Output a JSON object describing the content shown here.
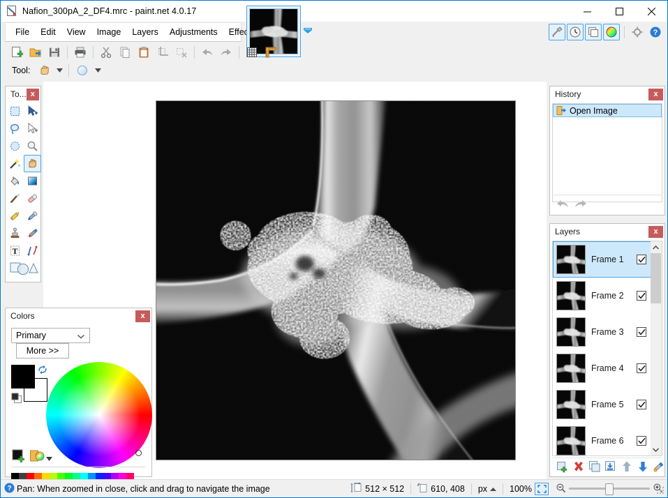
{
  "window": {
    "title": "Nafion_300pA_2_DF4.mrc - paint.net 4.0.17",
    "icon": "paintnet-document-icon",
    "controls": {
      "minimize": "—",
      "maximize": "□",
      "close": "✕"
    }
  },
  "menu": {
    "items": [
      {
        "label": "File"
      },
      {
        "label": "Edit"
      },
      {
        "label": "View"
      },
      {
        "label": "Image"
      },
      {
        "label": "Layers"
      },
      {
        "label": "Adjustments"
      },
      {
        "label": "Effects"
      }
    ]
  },
  "image_tabs": {
    "selected_index": 0,
    "tabs": [
      {
        "name": "Nafion_300pA_2_DF4.mrc",
        "thumbnail": "micrograph-thumbnail"
      }
    ],
    "overflow_icon": "chevron-down-icon"
  },
  "toolbar": {
    "buttons": [
      {
        "name": "new-image-button",
        "icon": "new-document-icon"
      },
      {
        "name": "open-image-button",
        "icon": "open-folder-icon"
      },
      {
        "name": "save-button",
        "icon": "floppy-disk-icon"
      },
      {
        "name": "print-button",
        "icon": "printer-icon"
      },
      {
        "name": "cut-button",
        "icon": "scissors-icon"
      },
      {
        "name": "copy-button",
        "icon": "copy-pages-icon"
      },
      {
        "name": "paste-button",
        "icon": "clipboard-icon"
      },
      {
        "name": "crop-to-selection-button",
        "icon": "crop-icon"
      },
      {
        "name": "deselect-all-button",
        "icon": "deselect-icon"
      },
      {
        "name": "undo-button",
        "icon": "undo-arrow-icon"
      },
      {
        "name": "redo-button",
        "icon": "redo-arrow-icon"
      },
      {
        "name": "pixel-grid-button",
        "icon": "grid-icon"
      },
      {
        "name": "rulers-button",
        "icon": "ruler-icon"
      }
    ],
    "right_buttons": [
      {
        "name": "tools-window-button",
        "icon": "tools-hammer-icon",
        "active": true
      },
      {
        "name": "history-window-button",
        "icon": "clock-icon",
        "active": true
      },
      {
        "name": "layers-window-button",
        "icon": "layers-stack-icon",
        "active": true
      },
      {
        "name": "colors-window-button",
        "icon": "color-wheel-icon",
        "active": true
      },
      {
        "name": "settings-button",
        "icon": "gear-icon",
        "active": false
      },
      {
        "name": "help-button",
        "icon": "help-question-icon",
        "active": false
      }
    ]
  },
  "tool_row": {
    "label": "Tool:",
    "active_tool_icon": "pan-hand-icon",
    "brush_icon": "antialiasing-icon",
    "dropdown_icon": "chevron-down-icon"
  },
  "tools_panel": {
    "title": "To...",
    "close_label": "x",
    "selected_tool": "pan",
    "tools": [
      {
        "name": "rectangle-select-tool",
        "icon": "rectangle-select-icon",
        "selected": false
      },
      {
        "name": "move-selected-tool",
        "icon": "move-selected-icon",
        "selected": false
      },
      {
        "name": "lasso-select-tool",
        "icon": "lasso-select-icon",
        "selected": false
      },
      {
        "name": "move-selection-tool",
        "icon": "move-selection-icon",
        "selected": false
      },
      {
        "name": "ellipse-select-tool",
        "icon": "ellipse-select-icon",
        "selected": false
      },
      {
        "name": "zoom-tool",
        "icon": "magnifier-icon",
        "selected": false
      },
      {
        "name": "magic-wand-tool",
        "icon": "magic-wand-icon",
        "selected": false
      },
      {
        "name": "pan-tool",
        "icon": "pan-hand-icon",
        "selected": true
      },
      {
        "name": "paint-bucket-tool",
        "icon": "paint-bucket-icon",
        "selected": false
      },
      {
        "name": "gradient-tool",
        "icon": "gradient-icon",
        "selected": false
      },
      {
        "name": "paintbrush-tool",
        "icon": "paintbrush-icon",
        "selected": false
      },
      {
        "name": "eraser-tool",
        "icon": "eraser-icon",
        "selected": false
      },
      {
        "name": "pencil-tool",
        "icon": "pencil-icon",
        "selected": false
      },
      {
        "name": "color-picker-tool",
        "icon": "eyedropper-icon",
        "selected": false
      },
      {
        "name": "clone-stamp-tool",
        "icon": "clone-stamp-icon",
        "selected": false
      },
      {
        "name": "recolor-tool",
        "icon": "recolor-icon",
        "selected": false
      },
      {
        "name": "text-tool",
        "icon": "text-t-icon",
        "selected": false
      },
      {
        "name": "line-curve-tool",
        "icon": "line-curve-icon",
        "selected": false
      },
      {
        "name": "shapes-tool",
        "icon": "shapes-icon",
        "selected": false
      }
    ]
  },
  "colors_panel": {
    "title": "Colors",
    "close_label": "x",
    "selected_channel": "Primary",
    "more_label": "More >>",
    "primary_color": "#000000",
    "secondary_color": "#ffffff",
    "swap_icon": "swap-colors-icon",
    "reset_icon": "reset-colors-icon",
    "add_color_icon": "add-color-icon",
    "palette_file_icon": "palette-file-icon",
    "palette_dropdown_icon": "chevron-down-icon",
    "palette_row1": [
      "#000000",
      "#404040",
      "#ff0000",
      "#ff6a00",
      "#ffd800",
      "#b6ff00",
      "#4cff00",
      "#00ff21",
      "#00ff90",
      "#00ffff",
      "#0094ff",
      "#0026ff",
      "#4800ff",
      "#b200ff",
      "#ff00dc",
      "#ff006e"
    ],
    "palette_row2": [
      "#ffffff",
      "#808080",
      "#7f0000",
      "#7f3300",
      "#7f6a00",
      "#5b7f00",
      "#267f00",
      "#007f0e",
      "#007f46",
      "#007f7f",
      "#004a7f",
      "#00137f",
      "#21007f",
      "#57007f",
      "#7f006e",
      "#7f0037"
    ]
  },
  "canvas": {
    "document_name": "Nafion_300pA_2_DF4.mrc",
    "background": "#000000",
    "content_description": "dark-field electron micrograph of branching fiber junction with granular deposit"
  },
  "history_panel": {
    "title": "History",
    "close_label": "x",
    "items": [
      {
        "label": "Open Image",
        "icon": "open-image-icon",
        "selected": true
      }
    ],
    "undo_icon": "undo-arrow-icon",
    "redo_icon": "redo-arrow-icon"
  },
  "layers_panel": {
    "title": "Layers",
    "close_label": "x",
    "layers": [
      {
        "label": "Frame 1",
        "visible": true,
        "selected": true
      },
      {
        "label": "Frame 2",
        "visible": true,
        "selected": false
      },
      {
        "label": "Frame 3",
        "visible": true,
        "selected": false
      },
      {
        "label": "Frame 4",
        "visible": true,
        "selected": false
      },
      {
        "label": "Frame 5",
        "visible": true,
        "selected": false
      },
      {
        "label": "Frame 6",
        "visible": true,
        "selected": false
      }
    ],
    "buttons": [
      {
        "name": "add-new-layer-button",
        "icon": "add-layer-icon"
      },
      {
        "name": "delete-layer-button",
        "icon": "delete-layer-icon"
      },
      {
        "name": "duplicate-layer-button",
        "icon": "duplicate-layer-icon"
      },
      {
        "name": "merge-layer-down-button",
        "icon": "merge-down-icon"
      },
      {
        "name": "move-layer-up-button",
        "icon": "arrow-up-icon"
      },
      {
        "name": "move-layer-down-button",
        "icon": "arrow-down-icon"
      },
      {
        "name": "layer-properties-button",
        "icon": "layer-properties-icon"
      }
    ],
    "scroll_up_icon": "chevron-up-icon",
    "scroll_down_icon": "chevron-down-icon"
  },
  "status_bar": {
    "help_icon": "help-question-icon",
    "help_text": "Pan: When zoomed in close, click and drag to navigate the image",
    "size_icon": "image-size-icon",
    "image_size": "512 × 512",
    "cursor_icon": "cursor-position-icon",
    "cursor_position": "610, 408",
    "units": "px",
    "units_dropdown_icon": "chevron-up-icon",
    "zoom_level": "100%",
    "fit_window_icon": "fit-to-window-icon",
    "zoom_out_icon": "zoom-out-icon",
    "zoom_in_icon": "zoom-in-icon"
  }
}
